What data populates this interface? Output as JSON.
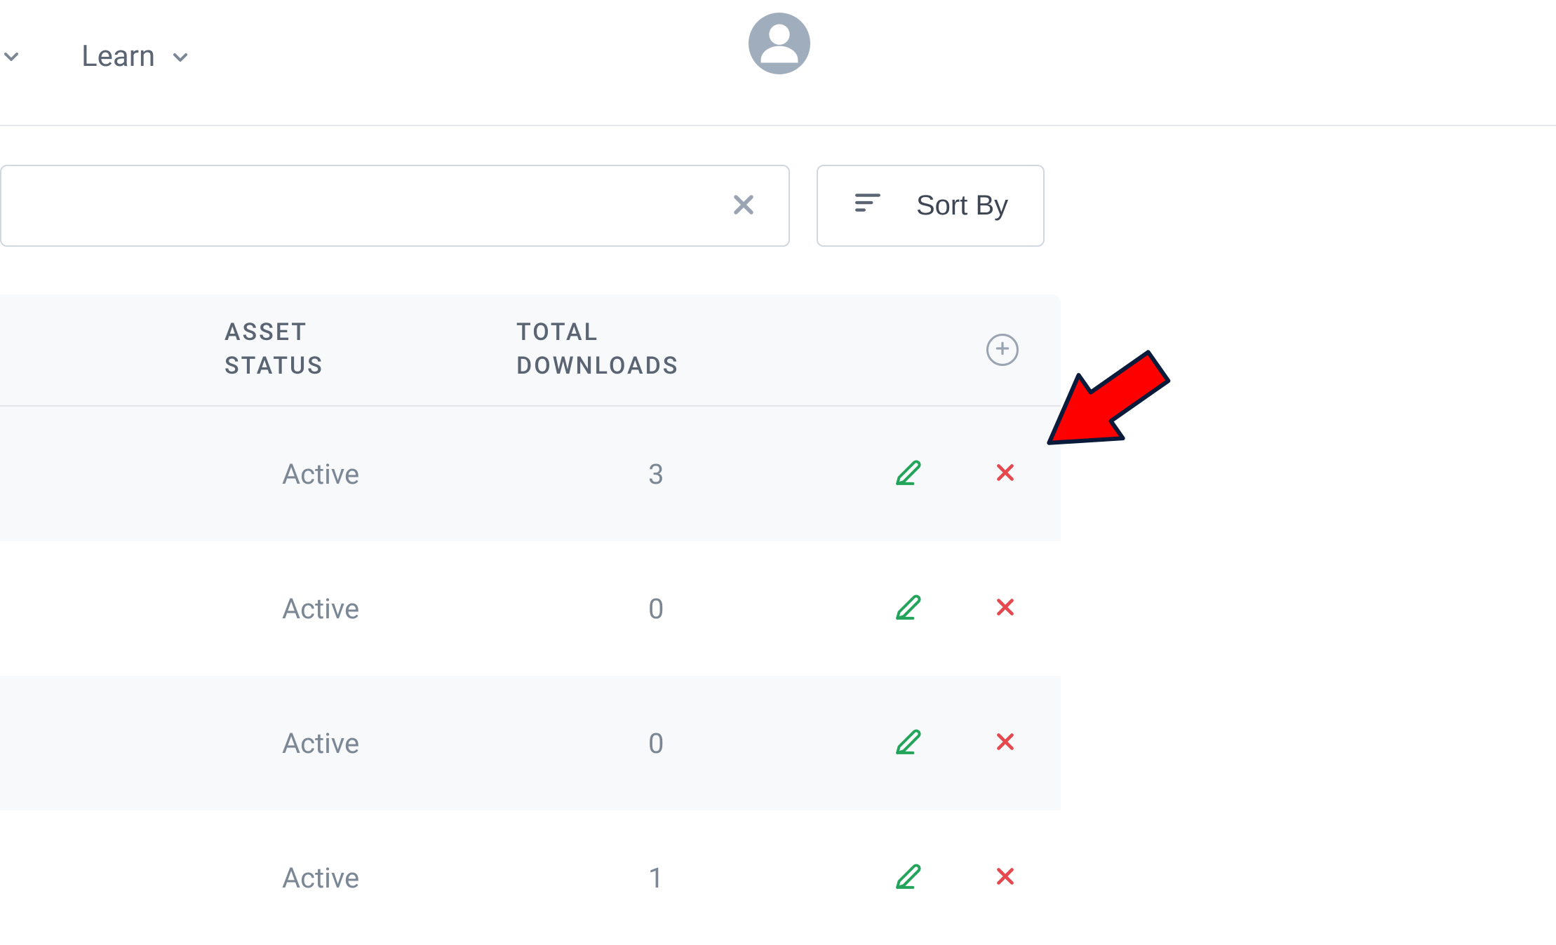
{
  "nav": {
    "learn_label": "Learn"
  },
  "controls": {
    "sort_label": "Sort By"
  },
  "table": {
    "headers": {
      "asset_status": "ASSET STATUS",
      "total_downloads": "TOTAL DOWNLOADS"
    },
    "rows": [
      {
        "status": "Active",
        "downloads": "3"
      },
      {
        "status": "Active",
        "downloads": "0"
      },
      {
        "status": "Active",
        "downloads": "0"
      },
      {
        "status": "Active",
        "downloads": "1"
      }
    ]
  }
}
